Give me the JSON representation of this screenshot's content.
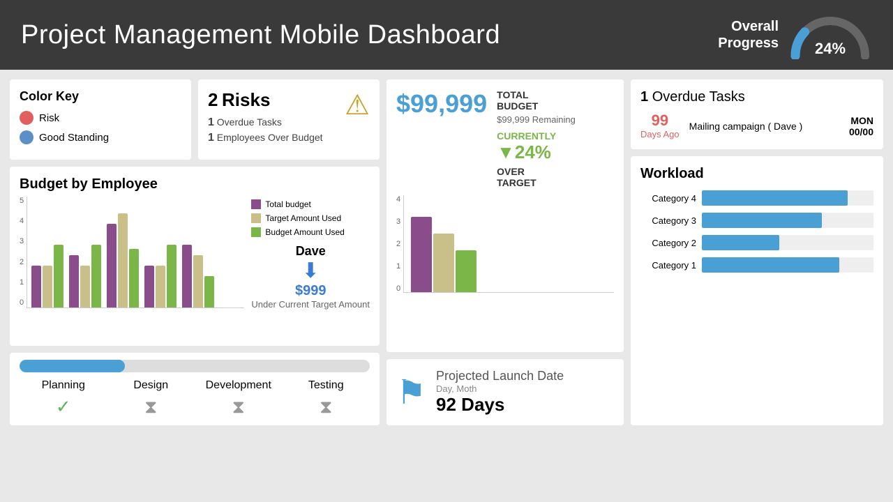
{
  "header": {
    "title": "Project Management Mobile Dashboard",
    "overall_progress_label": "Overall\nProgress",
    "overall_progress_pct": "24%",
    "gauge_pct": 24
  },
  "color_key": {
    "title": "Color Key",
    "items": [
      {
        "label": "Risk",
        "color": "#e06060"
      },
      {
        "label": "Good Standing",
        "color": "#5a8fc8"
      }
    ]
  },
  "risks": {
    "title": "Risks",
    "count": "2",
    "items": [
      {
        "count": "1",
        "label": "Overdue Tasks"
      },
      {
        "count": "1",
        "label": "Employees Over Budget"
      }
    ]
  },
  "budget_by_employee": {
    "title": "Budget by Employee",
    "legend": [
      {
        "label": "Total budget",
        "color": "#8b4c8b"
      },
      {
        "label": "Target Amount Used",
        "color": "#c8c088"
      },
      {
        "label": "Budget Amount Used",
        "color": "#7ab648"
      }
    ],
    "bars": [
      {
        "total": 2,
        "target": 2,
        "used": 3
      },
      {
        "total": 2.5,
        "target": 2,
        "used": 3
      },
      {
        "total": 4,
        "target": 4.5,
        "used": 2.8
      },
      {
        "total": 2,
        "target": 2,
        "used": 3
      },
      {
        "total": 3,
        "target": 2.5,
        "used": 1.5
      }
    ],
    "y_labels": [
      "5",
      "4",
      "3",
      "2",
      "1",
      "0"
    ],
    "dave": {
      "name": "Dave",
      "amount": "$999",
      "sublabel": "Under Current Target Amount"
    }
  },
  "total_budget": {
    "amount": "$99,999",
    "label": "TOTAL\nBUDGET",
    "remaining": "$99,999 Remaining",
    "currently_label": "CURRENTLY",
    "currently_pct": "▼24%",
    "over_target": "OVER\nTARGET",
    "chart_bars": [
      {
        "label": "",
        "val1": 3.6,
        "val2": 2.8,
        "val3": 2.0
      }
    ],
    "y_labels": [
      "4",
      "3",
      "2",
      "1",
      "0"
    ]
  },
  "launch": {
    "title": "Projected\nLaunch Date",
    "sub": "Day, Moth",
    "days": "92 Days"
  },
  "overdue": {
    "title": "Overdue Tasks",
    "count": "1",
    "item": {
      "days_ago": "99",
      "days_label": "Days Ago",
      "description": "Mailing campaign ( Dave )",
      "date": "MON\n00/00"
    }
  },
  "workload": {
    "title": "Workload",
    "categories": [
      {
        "label": "Category 4",
        "pct": 85
      },
      {
        "label": "Category 3",
        "pct": 70
      },
      {
        "label": "Category 2",
        "pct": 45
      },
      {
        "label": "Category 1",
        "pct": 80
      }
    ]
  },
  "phases": {
    "progress_pct": 30,
    "items": [
      {
        "label": "Planning",
        "icon": "✓",
        "complete": true
      },
      {
        "label": "Design",
        "icon": "⧗",
        "complete": false
      },
      {
        "label": "Development",
        "icon": "⧗",
        "complete": false
      },
      {
        "label": "Testing",
        "icon": "⧗",
        "complete": false
      }
    ]
  }
}
